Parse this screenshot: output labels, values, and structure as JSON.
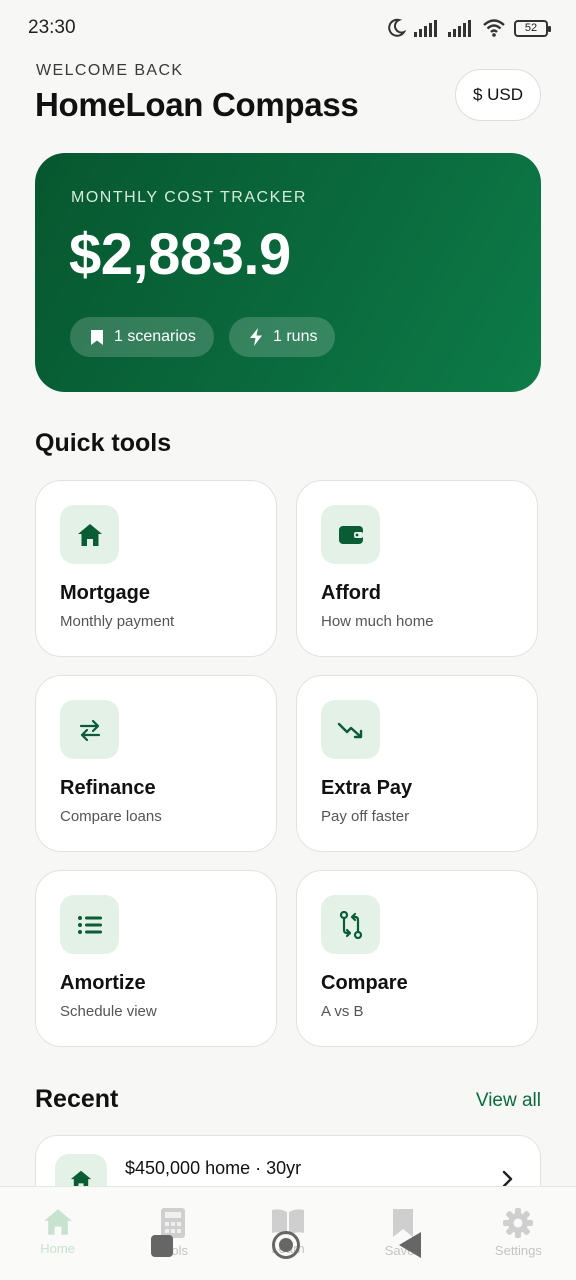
{
  "status_bar": {
    "time": "23:30",
    "battery": "52"
  },
  "header": {
    "eyebrow": "WELCOME BACK",
    "title": "HomeLoan Compass",
    "currency_button": "$ USD"
  },
  "hero": {
    "label": "MONTHLY COST TRACKER",
    "value": "$2,883.9",
    "chips": [
      {
        "icon": "bookmark-icon",
        "label": "1 scenarios"
      },
      {
        "icon": "bolt-icon",
        "label": "1 runs"
      }
    ]
  },
  "quick_tools": {
    "title": "Quick tools",
    "items": [
      {
        "icon": "home-icon",
        "name": "Mortgage",
        "desc": "Monthly payment"
      },
      {
        "icon": "wallet-icon",
        "name": "Afford",
        "desc": "How much home"
      },
      {
        "icon": "swap-arrows-icon",
        "name": "Refinance",
        "desc": "Compare loans"
      },
      {
        "icon": "trending-down-icon",
        "name": "Extra Pay",
        "desc": "Pay off faster"
      },
      {
        "icon": "list-icon",
        "name": "Amortize",
        "desc": "Schedule view"
      },
      {
        "icon": "compare-arrows-icon",
        "name": "Compare",
        "desc": "A vs B"
      }
    ]
  },
  "recent": {
    "title": "Recent",
    "view_all": "View all",
    "items": [
      {
        "icon": "home-icon",
        "label": "$450,000 home · 30yr"
      }
    ]
  },
  "bottom_nav": {
    "items": [
      {
        "icon": "home-icon",
        "label": "Home",
        "active": true
      },
      {
        "icon": "calculator-icon",
        "label": "Tools",
        "active": false
      },
      {
        "icon": "book-icon",
        "label": "Learn",
        "active": false
      },
      {
        "icon": "bookmark-icon",
        "label": "Saved",
        "active": false
      },
      {
        "icon": "gear-icon",
        "label": "Settings",
        "active": false
      }
    ]
  },
  "colors": {
    "brand_dark": "#07572f",
    "brand": "#0b6b3c",
    "icon_tile": "#e3f1e6"
  }
}
